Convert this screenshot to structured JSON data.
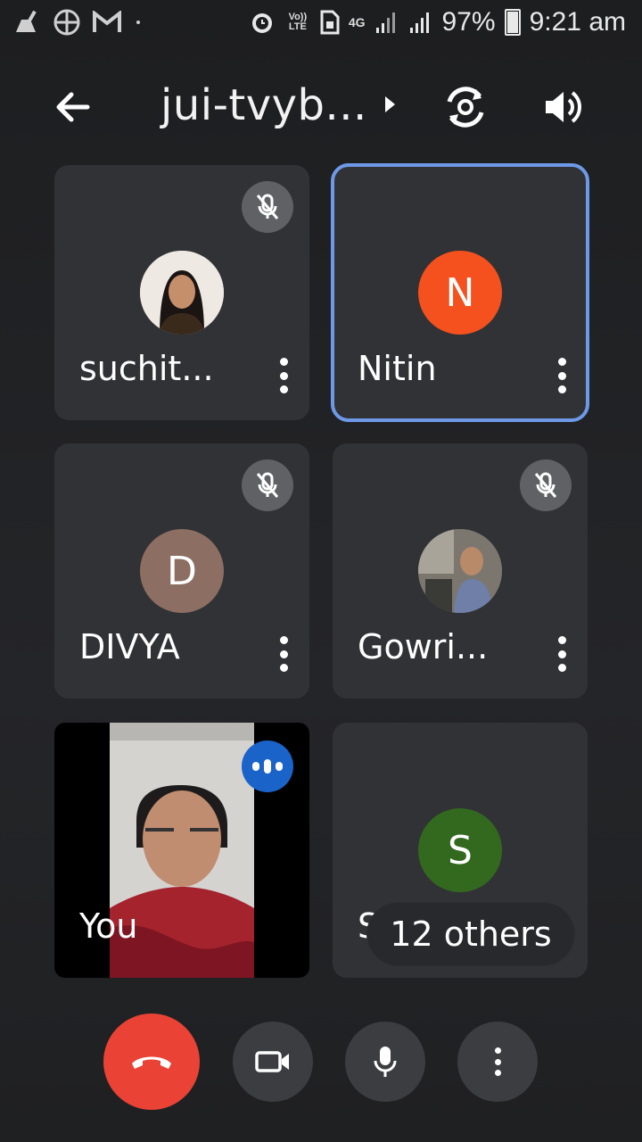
{
  "status_bar": {
    "volte": "Vo)) LTE",
    "network": "4G",
    "battery": "97%",
    "time": "9:21 am"
  },
  "header": {
    "meeting_title": "jui-tvyb..."
  },
  "participants": [
    {
      "name": "suchit...",
      "avatar_type": "photo",
      "muted": true,
      "active": false
    },
    {
      "name": "Nitin",
      "initial": "N",
      "avatar_color": "#f4511e",
      "muted": false,
      "active": true
    },
    {
      "name": "DIVYA",
      "initial": "D",
      "avatar_color": "#8d6e63",
      "muted": true,
      "active": false
    },
    {
      "name": "Gowri...",
      "avatar_type": "photo",
      "muted": true,
      "active": false
    },
    {
      "name": "You",
      "avatar_type": "video",
      "speaking": true
    },
    {
      "name": "Sri",
      "initial": "S",
      "avatar_color": "#33691e",
      "muted": false,
      "active": false
    }
  ],
  "others_label": "12 others",
  "controls": {
    "end_call_color": "#ea4335",
    "accent_color": "#6d99e8"
  }
}
